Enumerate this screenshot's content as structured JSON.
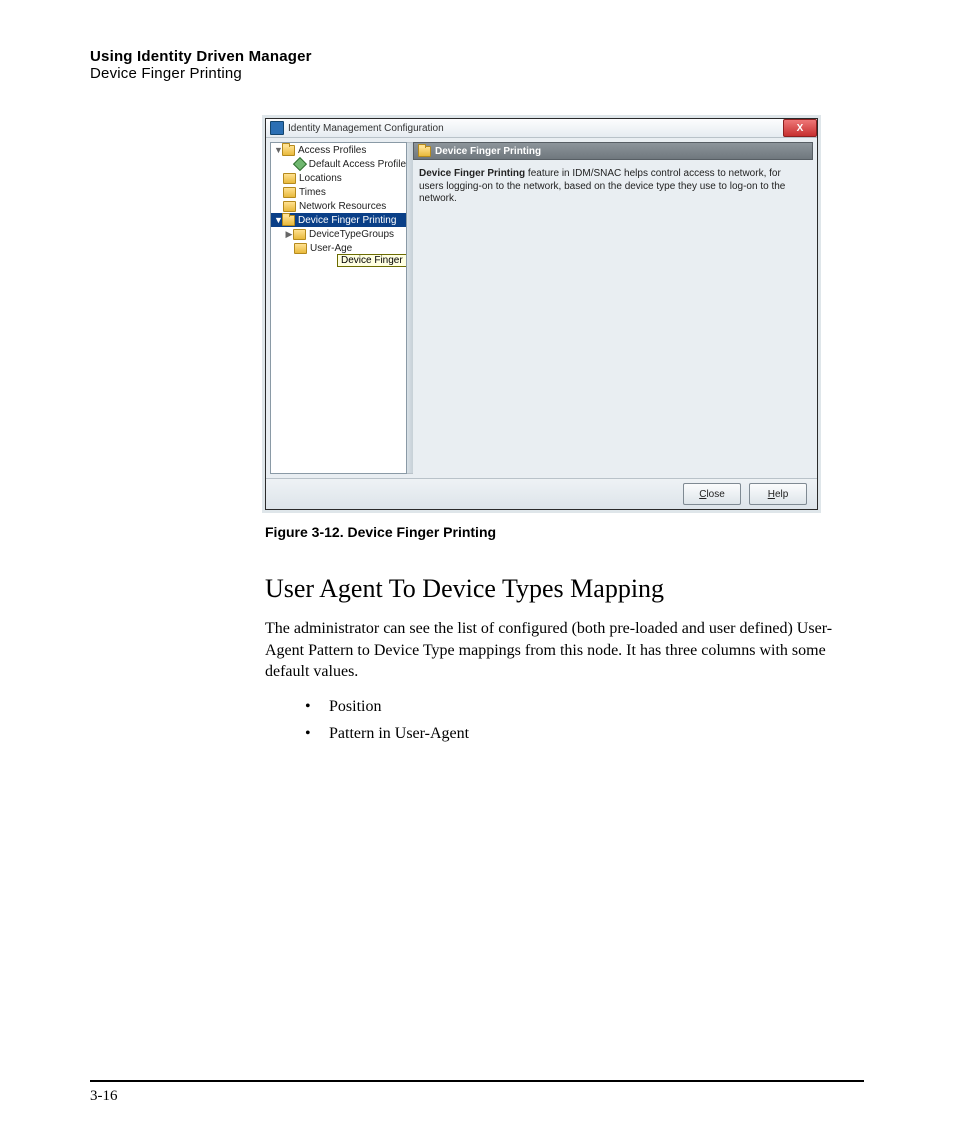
{
  "header": {
    "title_bold": "Using Identity Driven Manager",
    "title_light": "Device Finger Printing"
  },
  "window": {
    "title": "Identity Management Configuration",
    "close_glyph": "X",
    "tree": {
      "n0": {
        "label": "Access Profiles"
      },
      "n0a": {
        "label": "Default Access Profile"
      },
      "n1": {
        "label": "Locations"
      },
      "n2": {
        "label": "Times"
      },
      "n3": {
        "label": "Network Resources"
      },
      "n4": {
        "label": "Device Finger Printing"
      },
      "n4a": {
        "label": "DeviceTypeGroups"
      },
      "n4b": {
        "label": "User-Age"
      }
    },
    "tooltip": "Device Finger Printing",
    "crumb": "Device Finger Printing",
    "desc_bold": "Device Finger Printing",
    "desc_rest": " feature in IDM/SNAC helps control access to network, for users logging-on to the network, based on the device type they use to log-on to the network.",
    "close_btn": "Close",
    "help_btn": "Help"
  },
  "caption": "Figure 3-12. Device Finger Printing",
  "body": {
    "h2": "User Agent To Device Types Mapping",
    "para": "The administrator can see the list of configured (both pre-loaded and user defined) User-Agent Pattern to Device Type mappings from this node. It has three columns with some default values.",
    "b1": "Position",
    "b2": "Pattern in User-Agent"
  },
  "page_number": "3-16"
}
